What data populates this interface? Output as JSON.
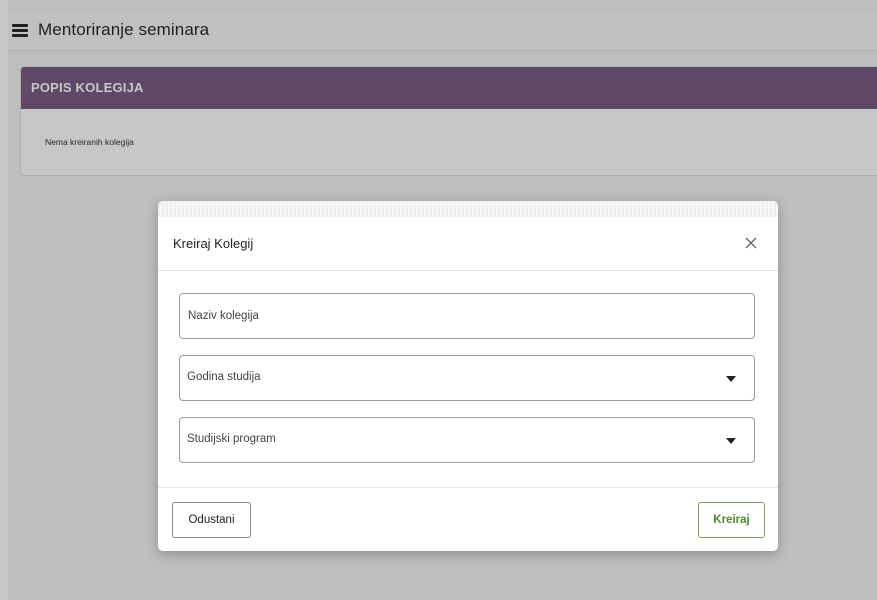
{
  "topbar": {
    "menu_icon": "hamburger-menu-icon",
    "title": "Mentoriranje seminara"
  },
  "card": {
    "header": "POPIS KOLEGIJA",
    "empty_text": "Nema kreiranih kolegija",
    "header_color": "#7c5e86"
  },
  "modal": {
    "title": "Kreiraj Kolegij",
    "close_icon": "close-icon",
    "fields": {
      "course_name": {
        "placeholder": "Naziv kolegija",
        "value": ""
      },
      "study_year": {
        "label": "Godina studija",
        "value": ""
      },
      "study_program": {
        "label": "Studijski program",
        "value": ""
      }
    },
    "buttons": {
      "cancel": "Odustani",
      "create": "Kreiraj"
    },
    "create_color": "#4d8a2a"
  }
}
